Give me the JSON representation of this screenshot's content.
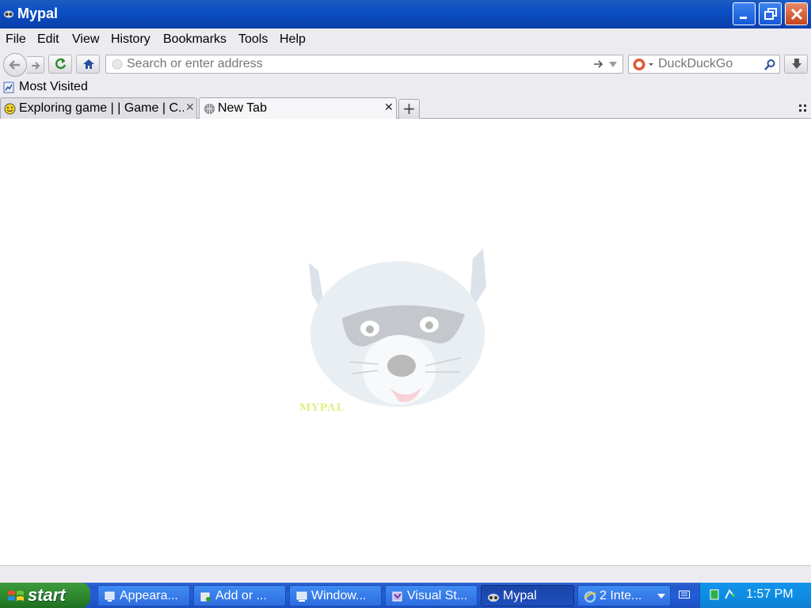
{
  "window": {
    "title": "Mypal"
  },
  "menubar": {
    "items": [
      "File",
      "Edit",
      "View",
      "History",
      "Bookmarks",
      "Tools",
      "Help"
    ]
  },
  "navbar": {
    "url_placeholder": "Search or enter address",
    "url_value": "",
    "search_placeholder": "DuckDuckGo",
    "search_value": ""
  },
  "bookmarks": {
    "items": [
      "Most Visited"
    ]
  },
  "tabs": [
    {
      "label": "Exploring game | | Game | C...",
      "active": false
    },
    {
      "label": "New Tab",
      "active": true
    }
  ],
  "content": {
    "logo_text": "MYPAL"
  },
  "taskbar": {
    "start_label": "start",
    "tasks": [
      {
        "label": "Appeara...",
        "icon": "display-properties-icon",
        "active": false
      },
      {
        "label": "Add or ...",
        "icon": "add-remove-programs-icon",
        "active": false
      },
      {
        "label": "Window...",
        "icon": "windows-explorer-icon",
        "active": false
      },
      {
        "label": "Visual St...",
        "icon": "visual-studio-icon",
        "active": false
      },
      {
        "label": "Mypal",
        "icon": "mypal-icon",
        "active": true
      },
      {
        "label": "2 Inte...",
        "icon": "internet-explorer-icon",
        "active": false
      }
    ],
    "clock": "1:57 PM"
  },
  "colors": {
    "titlebar": "#0b4fc6",
    "toolbar_bg": "#ecebf0",
    "taskbar": "#245edb",
    "start_green": "#2f8a2f",
    "tray": "#0d8de4"
  }
}
